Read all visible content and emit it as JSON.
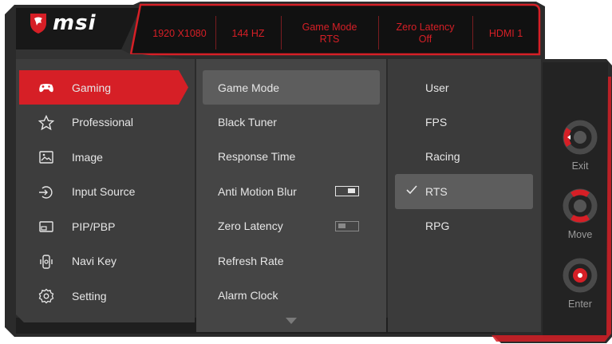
{
  "brand": {
    "name": "msi"
  },
  "status_bar": [
    {
      "lines": [
        "1920 X1080"
      ]
    },
    {
      "lines": [
        "144 HZ"
      ]
    },
    {
      "lines": [
        "Game Mode",
        "RTS"
      ]
    },
    {
      "lines": [
        "Zero Latency",
        "Off"
      ]
    },
    {
      "lines": [
        "HDMI 1"
      ]
    }
  ],
  "main_menu": [
    {
      "label": "Gaming",
      "icon": "gamepad-icon",
      "selected": true
    },
    {
      "label": "Professional",
      "icon": "star-icon"
    },
    {
      "label": "Image",
      "icon": "image-icon"
    },
    {
      "label": "Input Source",
      "icon": "input-source-icon"
    },
    {
      "label": "PIP/PBP",
      "icon": "pip-icon"
    },
    {
      "label": "Navi Key",
      "icon": "navi-key-icon"
    },
    {
      "label": "Setting",
      "icon": "gear-icon"
    }
  ],
  "sub_menu": [
    {
      "label": "Game Mode",
      "selected": true
    },
    {
      "label": "Black Tuner"
    },
    {
      "label": "Response Time"
    },
    {
      "label": "Anti Motion Blur",
      "toggle": "on"
    },
    {
      "label": "Zero Latency",
      "toggle": "off"
    },
    {
      "label": "Refresh Rate"
    },
    {
      "label": "Alarm Clock"
    }
  ],
  "options": [
    {
      "label": "User"
    },
    {
      "label": "FPS"
    },
    {
      "label": "Racing"
    },
    {
      "label": "RTS",
      "selected": true
    },
    {
      "label": "RPG"
    }
  ],
  "nav_keys": [
    {
      "caption": "Exit",
      "icon": "joystick-left-icon"
    },
    {
      "caption": "Move",
      "icon": "joystick-updown-icon"
    },
    {
      "caption": "Enter",
      "icon": "joystick-press-icon"
    }
  ],
  "colors": {
    "accent": "#d61f26",
    "panel": "#3c3c3c",
    "panel_light": "#464646",
    "dark": "#1c1c1c",
    "frame": "#2a2a2a"
  }
}
